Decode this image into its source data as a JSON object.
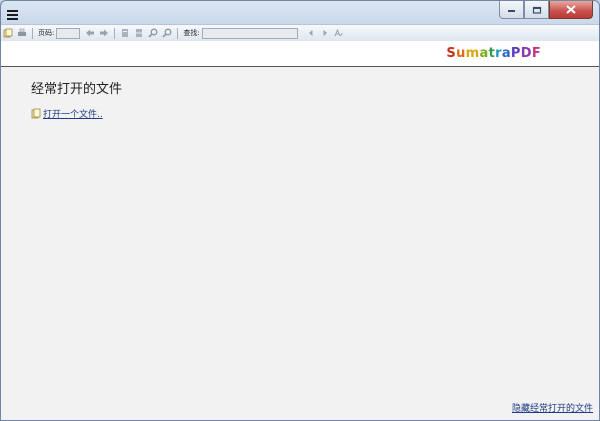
{
  "titlebar": {
    "menu_icon": "hamburger-menu-icon",
    "minimize_icon": "minimize-icon",
    "maximize_icon": "maximize-icon",
    "close_icon": "close-icon"
  },
  "toolbar": {
    "page_label": "页码:",
    "page_value": "",
    "find_label": "查找:",
    "find_value": "",
    "icons": [
      "open-file-icon",
      "print-icon",
      "back-icon",
      "forward-icon",
      "single-page-icon",
      "facing-pages-icon",
      "zoom-out-icon",
      "zoom-in-icon",
      "find-previous-icon",
      "find-next-icon",
      "match-case-icon"
    ]
  },
  "logo": {
    "letters": [
      "S",
      "u",
      "m",
      "a",
      "t",
      "r",
      "a",
      "P",
      "D",
      "F"
    ],
    "colors": [
      "#c8321b",
      "#e06a16",
      "#dba60f",
      "#7cab1c",
      "#2f9e4c",
      "#1f96b4",
      "#2f67c4",
      "#5b3fbd",
      "#8b3ab2",
      "#c4348a"
    ]
  },
  "main": {
    "heading": "经常打开的文件",
    "open_link": "打开一个文件..",
    "open_icon": "open-document-icon",
    "hide_link": "隐藏经常打开的文件"
  }
}
